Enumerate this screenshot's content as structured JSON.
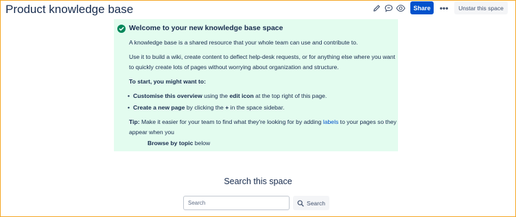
{
  "header": {
    "title": "Product knowledge base",
    "edit_icon": "pencil-icon",
    "comment_icon": "comment-icon",
    "watch_icon": "eye-icon",
    "share_label": "Share",
    "more_label": "•••",
    "unstar_label": "Unstar this space"
  },
  "panel": {
    "icon": "check-circle-icon",
    "background": "#e3fcef",
    "accent": "#00875a",
    "heading": "Welcome to your new knowledge base space",
    "intro": "A knowledge base is a shared resource that your whole team can use and contribute to.",
    "use_it": "Use it to build a wiki, create content to deflect help-desk requests, or for anything else where you want to quickly create lots of pages without worrying about organization and structure.",
    "to_start": "To start, you might want to:",
    "bullet1": {
      "bold1": "Customise this overview",
      "text1": " using the ",
      "bold2": "edit icon",
      "text2": " at the top right of this page."
    },
    "bullet2": {
      "bold1": "Create a new page",
      "text1": " by clicking the ",
      "bold2": "+",
      "text2": " in the space sidebar."
    },
    "tip": {
      "label": "Tip:",
      "text1": " Make it easier for your team to find what they're looking for by adding ",
      "link": "labels",
      "text2": " to your pages so they appear when you",
      "browse_bold": "Browse by topic",
      "browse_after": " below"
    }
  },
  "search": {
    "heading": "Search this space",
    "placeholder": "Search",
    "button_label": "Search",
    "button_icon": "search-icon"
  },
  "colors": {
    "primary": "#0052cc",
    "text": "#172b4d",
    "frame_border": "#f5a623"
  }
}
